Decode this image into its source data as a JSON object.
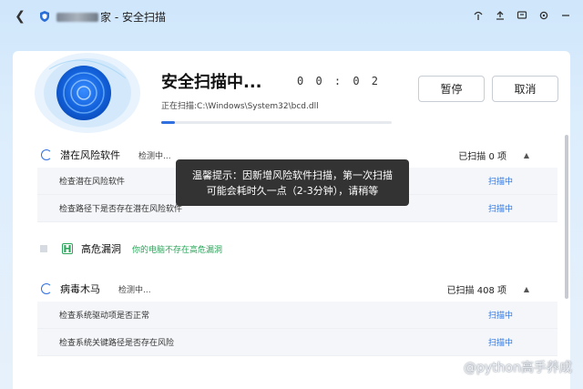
{
  "titlebar": {
    "title": "家 - 安全扫描",
    "icons": [
      "back-icon",
      "shield-icon",
      "skin-icon",
      "upload-icon",
      "feedback-icon",
      "settings-icon",
      "minimize-icon"
    ]
  },
  "scan": {
    "title": "安全扫描中...",
    "timer": "0 0 : 0 2",
    "path": "正在扫描:C:\\Windows\\System32\\bcd.dll",
    "progress": 0.06,
    "pause_label": "暂停",
    "cancel_label": "取消"
  },
  "sections": [
    {
      "name": "潜在风险软件",
      "status": "检测中...",
      "count": "已扫描 0 项",
      "rows": [
        {
          "label": "检查潜在风险软件",
          "status": "扫描中"
        },
        {
          "label": "检查路径下是否存在潜在风险软件",
          "status": "扫描中"
        }
      ]
    },
    {
      "name": "病毒木马",
      "status": "检测中...",
      "count": "已扫描 408 项",
      "rows": [
        {
          "label": "检查系统驱动项是否正常",
          "status": "扫描中"
        },
        {
          "label": "检查系统关键路径是否存在风险",
          "status": "扫描中"
        }
      ]
    }
  ],
  "high_risk": {
    "name": "高危漏洞",
    "note": "你的电脑不存在高危漏洞"
  },
  "tooltip": {
    "line1": "温馨提示：因新增风险软件扫描，第一次扫描",
    "line2": "可能会耗时久一点（2-3分钟），请稍等"
  },
  "watermark": "@python高手养成",
  "colors": {
    "accent": "#2f6fe0",
    "link": "#2f78e6",
    "success": "#2aa55a"
  }
}
